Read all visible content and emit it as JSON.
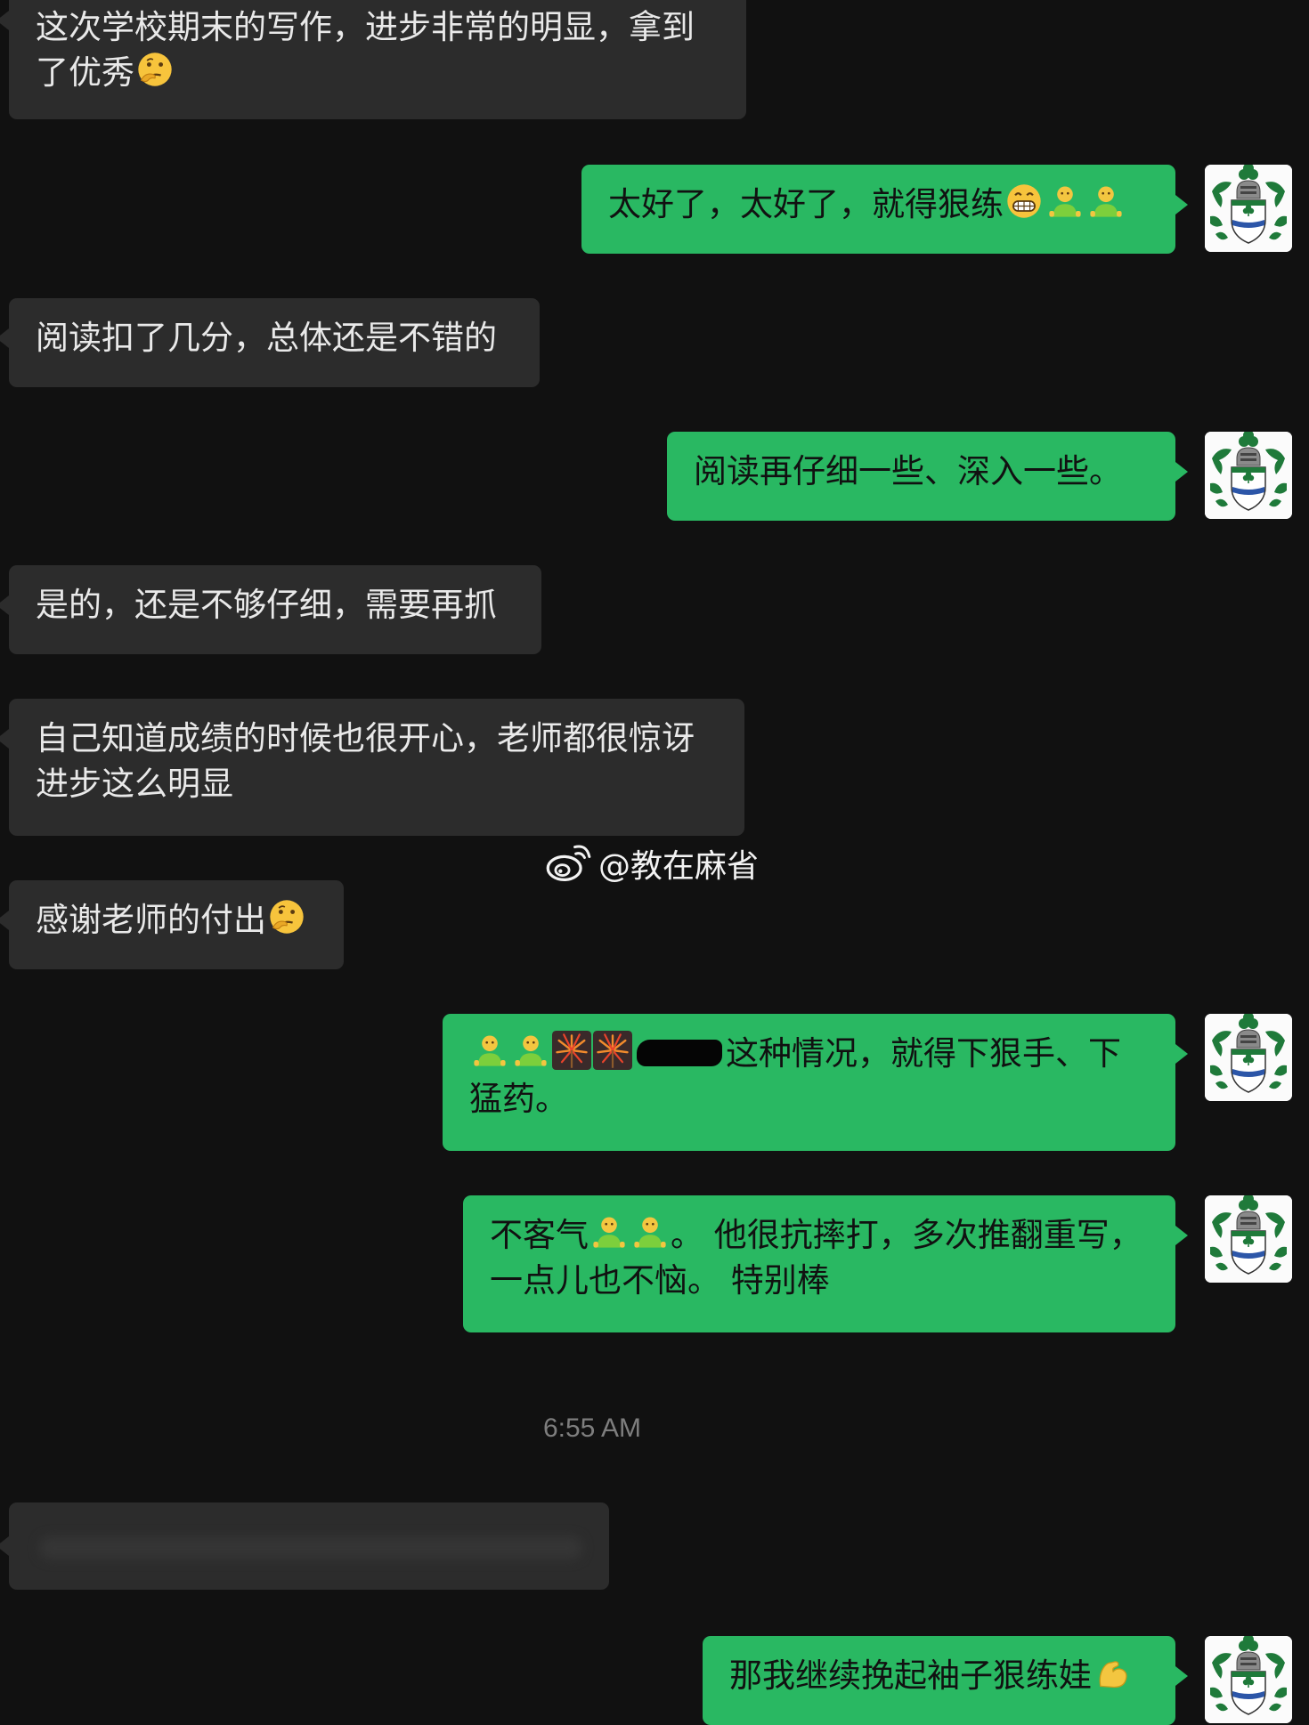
{
  "messages": {
    "m1": {
      "line1": "这次学校期末的写作，进步非常的明显，拿到",
      "line2": "了优秀",
      "emoji": "thinking-face"
    },
    "m2": {
      "text": "太好了，太好了，就得狠练",
      "emojis": [
        "grinning-face",
        "person-silhouette",
        "person-silhouette"
      ]
    },
    "m3": {
      "text": "阅读扣了几分，总体还是不错的"
    },
    "m4": {
      "text": "阅读再仔细一些、深入一些。"
    },
    "m5": {
      "text": "是的，还是不够仔细，需要再抓"
    },
    "m6": {
      "line1": "自己知道成绩的时候也很开心，老师都很惊讶",
      "line2": "进步这么明显"
    },
    "m7": {
      "text": "感谢老师的付出",
      "emoji": "thinking-face"
    },
    "m8": {
      "text_after_redaction": "这种情况，就得下狠手、下猛药。",
      "emojis": [
        "person-silhouette",
        "person-silhouette",
        "fireworks",
        "fireworks"
      ]
    },
    "m9": {
      "prefix": "不客气",
      "suffix": "。 他很抗摔打，多次推翻重写，一点儿也不恼。 特别棒",
      "emojis": [
        "person-silhouette",
        "person-silhouette"
      ]
    },
    "m10": {
      "text": "那我继续挽起袖子狠练娃",
      "emoji": "flexed-biceps"
    }
  },
  "timestamp": "6:55 AM",
  "watermark": {
    "text": "@教在麻省",
    "icon": "weibo-logo-icon"
  },
  "colors": {
    "background": "#111111",
    "incoming_bubble": "#2c2c2c",
    "outgoing_bubble": "#29b862",
    "incoming_text": "#e9e9e9",
    "outgoing_text": "#111111",
    "timestamp": "#7e7e7e"
  },
  "avatar": {
    "icon": "coat-of-arms-shamrock-icon"
  }
}
